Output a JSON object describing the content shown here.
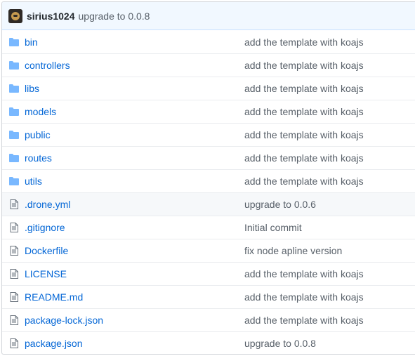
{
  "header": {
    "author": "sirius1024",
    "message": "upgrade to 0.0.8"
  },
  "files": [
    {
      "name": "bin",
      "type": "folder",
      "message": "add the template with koajs"
    },
    {
      "name": "controllers",
      "type": "folder",
      "message": "add the template with koajs"
    },
    {
      "name": "libs",
      "type": "folder",
      "message": "add the template with koajs"
    },
    {
      "name": "models",
      "type": "folder",
      "message": "add the template with koajs"
    },
    {
      "name": "public",
      "type": "folder",
      "message": "add the template with koajs"
    },
    {
      "name": "routes",
      "type": "folder",
      "message": "add the template with koajs"
    },
    {
      "name": "utils",
      "type": "folder",
      "message": "add the template with koajs"
    },
    {
      "name": ".drone.yml",
      "type": "file",
      "message": "upgrade to 0.0.6"
    },
    {
      "name": ".gitignore",
      "type": "file",
      "message": "Initial commit"
    },
    {
      "name": "Dockerfile",
      "type": "file",
      "message": "fix node apline version"
    },
    {
      "name": "LICENSE",
      "type": "file",
      "message": "add the template with koajs"
    },
    {
      "name": "README.md",
      "type": "file",
      "message": "add the template with koajs"
    },
    {
      "name": "package-lock.json",
      "type": "file",
      "message": "add the template with koajs"
    },
    {
      "name": "package.json",
      "type": "file",
      "message": "upgrade to 0.0.8"
    }
  ],
  "colors": {
    "folder_icon": "#79b8ff",
    "file_icon": "#6a737d",
    "link": "#0366d6"
  }
}
